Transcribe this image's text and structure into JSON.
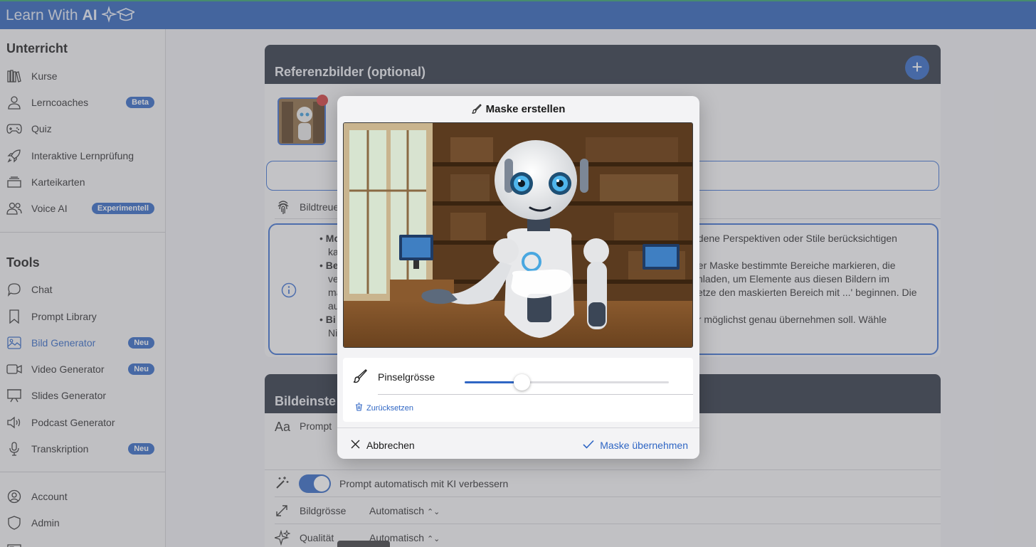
{
  "app": {
    "brand_text": "Learn With",
    "brand_bold": "AI"
  },
  "sidebar": {
    "sections": [
      {
        "title": "Unterricht"
      },
      {
        "title": "Tools"
      }
    ],
    "items": [
      {
        "label": "Kurse",
        "icon": "books-icon"
      },
      {
        "label": "Lerncoaches",
        "icon": "person-icon",
        "badge": "Beta"
      },
      {
        "label": "Quiz",
        "icon": "gamepad-icon"
      },
      {
        "label": "Interaktive Lernprüfung",
        "icon": "rocket-icon"
      },
      {
        "label": "Karteikarten",
        "icon": "cards-icon"
      },
      {
        "label": "Voice AI",
        "icon": "people-icon",
        "badge": "Experimentell"
      },
      {
        "label": "Chat",
        "icon": "chat-bubble-icon"
      },
      {
        "label": "Prompt Library",
        "icon": "bookmark-icon"
      },
      {
        "label": "Bild Generator",
        "icon": "image-icon",
        "badge": "Neu",
        "active": true
      },
      {
        "label": "Video Generator",
        "icon": "video-icon",
        "badge": "Neu"
      },
      {
        "label": "Slides Generator",
        "icon": "presentation-icon"
      },
      {
        "label": "Podcast Generator",
        "icon": "speaker-icon"
      },
      {
        "label": "Transkription",
        "icon": "microphone-icon",
        "badge": "Neu"
      },
      {
        "label": "Account",
        "icon": "account-icon"
      },
      {
        "label": "Admin",
        "icon": "shield-icon"
      }
    ]
  },
  "main": {
    "reference_card": {
      "title": "Referenzbilder (optional)",
      "fidelity_label": "Bildtreue",
      "info_lines": [
        "Mo",
        "ka",
        "Be",
        "ve",
        "ma",
        "au",
        "Bi",
        "Ni"
      ],
      "info_right_lines": [
        "edene Perspektiven oder Stile berücksichtigen",
        "her Maske bestimmte Bereiche markieren, die",
        "chladen, um Elemente aus diesen Bildern im",
        "setze den maskierten Bereich mit ...' beginnen. Die",
        "er möglichst genau übernehmen soll. Wähle"
      ]
    },
    "settings_card": {
      "title": "Bildeinste",
      "prompt_label": "Prompt",
      "auto_improve_label": "Prompt automatisch mit KI verbessern",
      "size_label": "Bildgrösse",
      "size_value": "Automatisch",
      "quality_label": "Qualität",
      "quality_value": "Automatisch"
    }
  },
  "modal": {
    "title": "Maske erstellen",
    "brush_label": "Pinselgrösse",
    "brush_value": 0.28,
    "reset_label": "Zurücksetzen",
    "cancel_label": "Abbrechen",
    "apply_label": "Maske übernehmen"
  },
  "colors": {
    "accent": "#2f66c4",
    "header": "#2a5fb8",
    "card_head": "#2b3242"
  }
}
